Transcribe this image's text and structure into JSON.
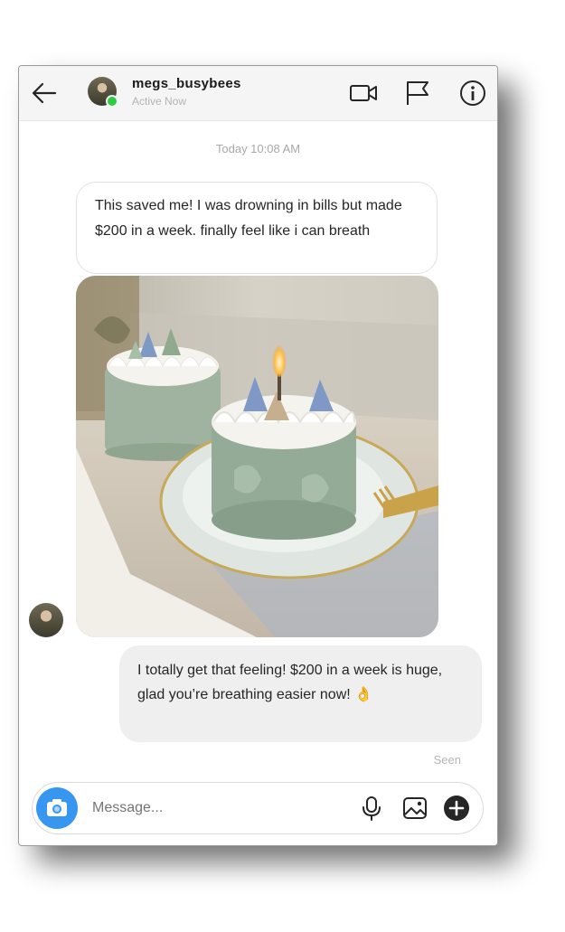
{
  "header": {
    "username": "megs_busybees",
    "status": "Active Now"
  },
  "conversation": {
    "timestamp": "Today 10:08 AM",
    "incoming_message": "This saved me! I was drowning in bills but made $200 in a week. finally feel like i can breath",
    "outgoing_message": "I totally get that feeling! $200 in a week is huge, glad you’re breathing easier now! 👌",
    "seen_label": "Seen"
  },
  "composer": {
    "placeholder": "Message..."
  },
  "icons": [
    "back-arrow-icon",
    "video-call-icon",
    "flag-icon",
    "info-icon",
    "camera-icon",
    "microphone-icon",
    "gallery-icon",
    "add-icon"
  ],
  "colors": {
    "accent": "#3797f0",
    "online": "#2ecc40"
  }
}
